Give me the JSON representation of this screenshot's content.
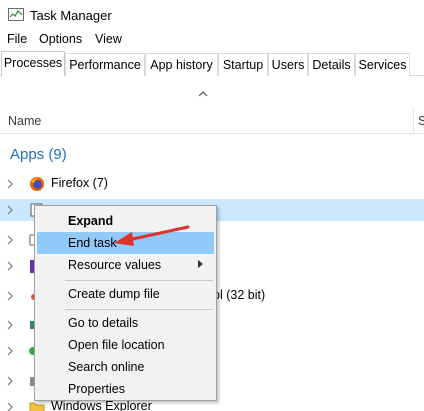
{
  "window": {
    "title": "Task Manager"
  },
  "menu": [
    "File",
    "Options",
    "View"
  ],
  "tabs": [
    "Processes",
    "Performance",
    "App history",
    "Startup",
    "Users",
    "Details",
    "Services"
  ],
  "columns": {
    "name": "Name",
    "status_partial": "S"
  },
  "group": {
    "title": "Apps (9)"
  },
  "rows": {
    "firefox": "Firefox (7)",
    "partial_bit": "ol (32 bit)",
    "windows_explorer": "Windows Explorer"
  },
  "context_menu": {
    "expand": "Expand",
    "end_task": "End task",
    "resource_values": "Resource values",
    "create_dump_file": "Create dump file",
    "go_to_details": "Go to details",
    "open_file_location": "Open file location",
    "search_online": "Search online",
    "properties": "Properties"
  },
  "colors": {
    "accent": "#1f6fbf",
    "selection": "#cce8ff",
    "menu_hover": "#91c9f7",
    "arrow": "#e0322d"
  }
}
